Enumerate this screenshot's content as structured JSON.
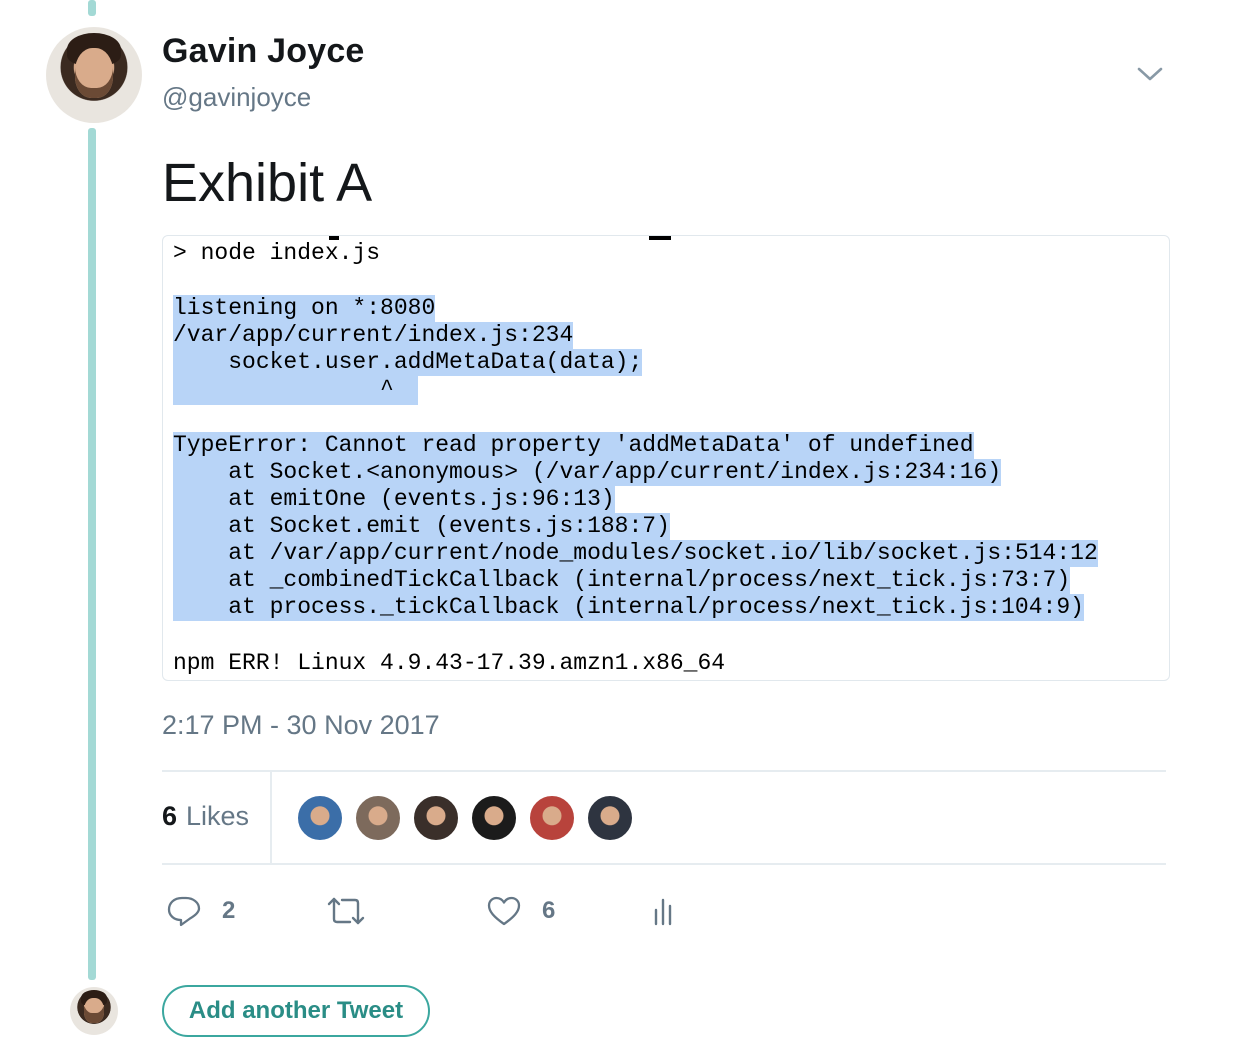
{
  "author": {
    "name": "Gavin Joyce",
    "handle": "@gavinjoyce"
  },
  "tweet": {
    "text": "Exhibit A",
    "timestamp": "2:17 PM - 30 Nov 2017"
  },
  "code_image": {
    "lines": [
      "> node index.js",
      "listening on *:8080",
      "/var/app/current/index.js:234",
      "    socket.user.addMetaData(data);",
      "               ^",
      "TypeError: Cannot read property 'addMetaData' of undefined",
      "    at Socket.<anonymous> (/var/app/current/index.js:234:16)",
      "    at emitOne (events.js:96:13)",
      "    at Socket.emit (events.js:188:7)",
      "    at /var/app/current/node_modules/socket.io/lib/socket.js:514:12",
      "    at _combinedTickCallback (internal/process/next_tick.js:73:7)",
      "    at process._tickCallback (internal/process/next_tick.js:104:9)",
      "npm ERR! Linux 4.9.43-17.39.amzn1.x86_64"
    ],
    "highlight_color": "#b8d4f7"
  },
  "likes": {
    "count": "6",
    "label": "Likes",
    "likers": [
      {
        "color": "#3b6ea8"
      },
      {
        "color": "#7d6a5c"
      },
      {
        "color": "#3a2f2a"
      },
      {
        "color": "#1b1b1b"
      },
      {
        "color": "#b8433c"
      },
      {
        "color": "#2e3440"
      }
    ]
  },
  "actions": {
    "reply_count": "2",
    "like_count": "6"
  },
  "add_tweet_label": "Add another Tweet",
  "colors": {
    "thread_line": "#a3d9d5",
    "secondary_text": "#657786",
    "add_button": "#2a8d86"
  }
}
